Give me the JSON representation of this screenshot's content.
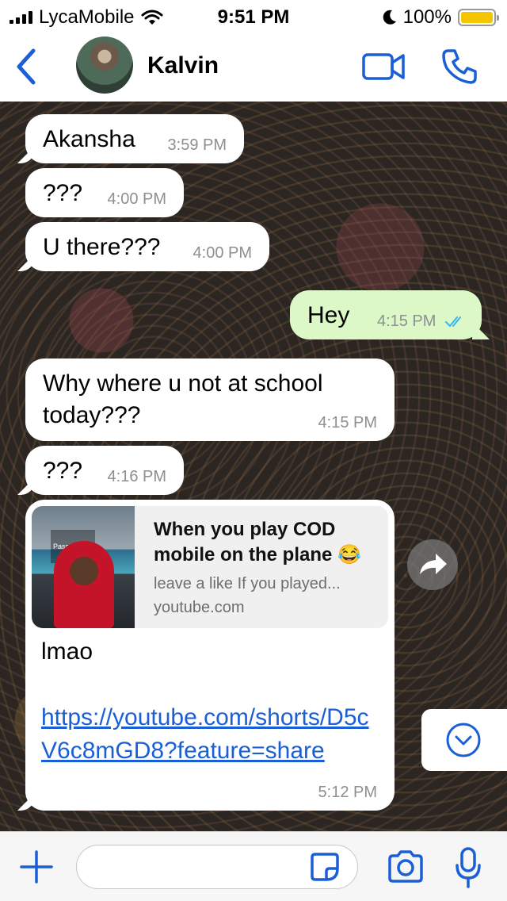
{
  "status_bar": {
    "carrier": "LycaMobile",
    "time": "9:51 PM",
    "battery": "100%"
  },
  "header": {
    "contact_name": "Kalvin"
  },
  "messages": [
    {
      "text": "Akansha",
      "time": "3:59 PM",
      "direction": "incoming"
    },
    {
      "text": "???",
      "time": "4:00 PM",
      "direction": "incoming"
    },
    {
      "text": "U there???",
      "time": "4:00 PM",
      "direction": "incoming"
    },
    {
      "text": "Hey",
      "time": "4:15 PM",
      "direction": "outgoing",
      "status": "read"
    },
    {
      "text": "Why where u not at school today???",
      "time": "4:15 PM",
      "direction": "incoming"
    },
    {
      "text": "???",
      "time": "4:16 PM",
      "direction": "incoming"
    }
  ],
  "link_message": {
    "preview_title": "When you play COD mobile on the plane 😂",
    "preview_description": "leave a like If you played...",
    "preview_domain": "youtube.com",
    "thumbnail_caption": "Passengers:",
    "text": "lmao",
    "link": "https://youtube.com/shorts/D5cV6c8mGD8?feature=share",
    "time": "5:12 PM",
    "direction": "incoming"
  },
  "input": {
    "placeholder": "",
    "value": ""
  },
  "colors": {
    "accent": "#1a5fd6",
    "outgoing_bubble": "#dcf8c6",
    "incoming_bubble": "#ffffff",
    "read_ticks": "#34b7f1"
  },
  "icons": [
    "back-chevron-icon",
    "video-call-icon",
    "phone-icon",
    "double-check-icon",
    "forward-icon",
    "chevron-down-circle-icon",
    "plus-icon",
    "sticker-icon",
    "camera-icon",
    "microphone-icon"
  ]
}
